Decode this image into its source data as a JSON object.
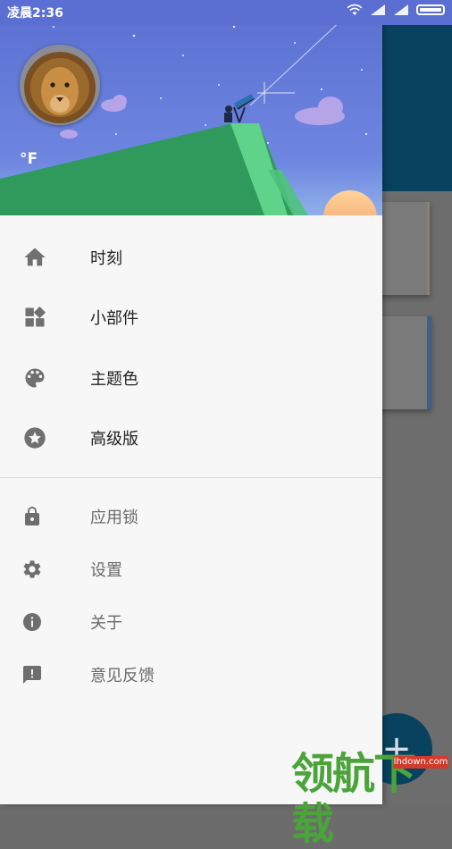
{
  "status_bar": {
    "time": "凌晨2:36"
  },
  "drawer": {
    "header": {
      "temperature_unit": "°F"
    },
    "primary_items": [
      {
        "label": "时刻",
        "icon": "home-icon"
      },
      {
        "label": "小部件",
        "icon": "widgets-icon"
      },
      {
        "label": "主题色",
        "icon": "palette-icon"
      },
      {
        "label": "高级版",
        "icon": "star-badge-icon"
      }
    ],
    "secondary_items": [
      {
        "label": "应用锁",
        "icon": "lock-icon"
      },
      {
        "label": "设置",
        "icon": "gear-icon"
      },
      {
        "label": "关于",
        "icon": "info-icon"
      },
      {
        "label": "意见反馈",
        "icon": "feedback-icon"
      }
    ]
  },
  "background_app": {
    "fab_label": "+"
  },
  "watermark": {
    "text": "领航下载",
    "url": "lhdown.com"
  },
  "colors": {
    "status_bar": "#5a6fd1",
    "app_header": "#08425f",
    "drawer_bg": "#f7f7f7",
    "hill_green": "#2f9a5c",
    "sky_top": "#5a6fd1"
  }
}
